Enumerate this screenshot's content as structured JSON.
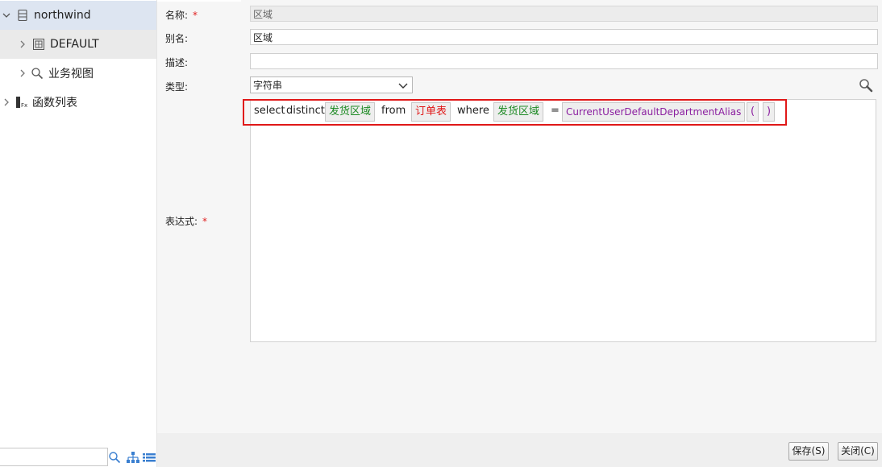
{
  "tree": {
    "items": [
      {
        "label": "northwind",
        "icon": "database-icon",
        "expanded": true
      },
      {
        "label": "DEFAULT",
        "icon": "schema-table-icon"
      },
      {
        "label": "业务视图",
        "icon": "magnifier-icon"
      },
      {
        "label": "函数列表",
        "icon": "function-list-icon"
      }
    ],
    "search_placeholder": ""
  },
  "form": {
    "name_label": "名称:",
    "name_value": "区域",
    "alias_label": "别名:",
    "alias_value": "区域",
    "desc_label": "描述:",
    "desc_value": "",
    "type_label": "类型:",
    "type_value": "字符串",
    "expr_label": "表达式:",
    "required_mark": "*"
  },
  "expression": {
    "tokens": [
      {
        "text": "select",
        "kind": "keyword"
      },
      {
        "text": "distinct",
        "kind": "keyword"
      },
      {
        "text": "发货区域",
        "kind": "field"
      },
      {
        "text": "from",
        "kind": "keyword"
      },
      {
        "text": "订单表",
        "kind": "table"
      },
      {
        "text": "where",
        "kind": "keyword"
      },
      {
        "text": "发货区域",
        "kind": "field"
      },
      {
        "text": "=",
        "kind": "operator"
      },
      {
        "text": "CurrentUserDefaultDepartmentAlias",
        "kind": "function"
      },
      {
        "text": "(",
        "kind": "function"
      },
      {
        "text": ")",
        "kind": "function"
      }
    ]
  },
  "buttons": {
    "save": "保存(S)",
    "close": "关闭(C)"
  },
  "colors": {
    "field": "#1d8a24",
    "table": "#e01818",
    "function": "#8b1fa0",
    "highlight_border": "#e01818",
    "selected_row": "#dde5f1"
  }
}
